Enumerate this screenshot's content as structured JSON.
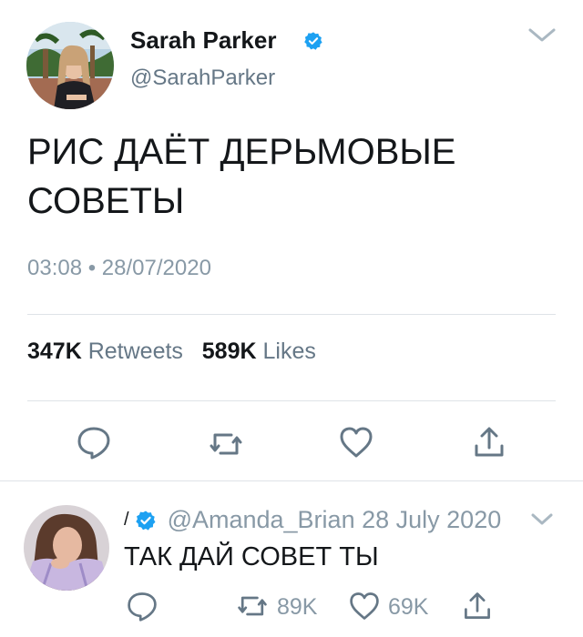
{
  "tweet": {
    "author_name": "Sarah Parker",
    "author_handle": "@SarahParker",
    "text": "РИС ДАЁТ ДЕРЬМОВЫЕ СОВЕТЫ",
    "timestamp": "03:08 • 28/07/2020",
    "retweets_count": "347K",
    "retweets_label": "Retweets",
    "likes_count": "589K",
    "likes_label": "Likes"
  },
  "reply": {
    "author_name_fragment": "/",
    "author_handle": "@Amanda_Brian",
    "date": "28 July 2020",
    "text": "ТАК ДАЙ СОВЕТ ТЫ",
    "retweets_count": "89K",
    "likes_count": "69K"
  },
  "colors": {
    "verified": "#1da1f2",
    "icon": "#657786",
    "text": "#14171a",
    "muted": "#8899a6"
  },
  "icons": {
    "reply": "reply-icon",
    "retweet": "retweet-icon",
    "like": "heart-icon",
    "share": "share-icon",
    "more": "chevron-down-icon",
    "verified": "verified-badge-icon"
  }
}
